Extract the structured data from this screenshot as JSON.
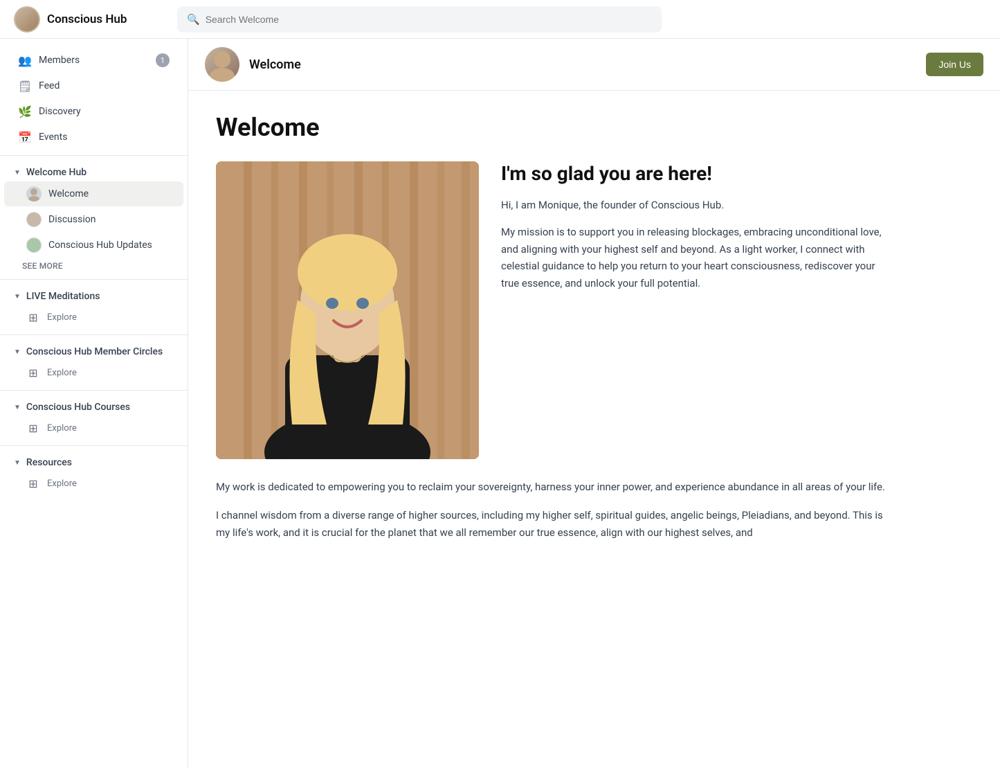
{
  "app": {
    "title": "Conscious Hub",
    "search_placeholder": "Search Welcome"
  },
  "topnav": {
    "join_button": "Join Us"
  },
  "sidebar": {
    "top_items": [
      {
        "id": "members",
        "label": "Members",
        "icon": "👥"
      },
      {
        "id": "feed",
        "label": "Feed",
        "icon": "🗒"
      },
      {
        "id": "discovery",
        "label": "Discovery",
        "icon": "🌿"
      },
      {
        "id": "events",
        "label": "Events",
        "icon": "📅"
      }
    ],
    "groups": [
      {
        "id": "welcome-hub",
        "label": "Welcome Hub",
        "expanded": true,
        "items": [
          {
            "id": "welcome",
            "label": "Welcome",
            "active": true,
            "has_avatar": true
          },
          {
            "id": "discussion",
            "label": "Discussion",
            "has_avatar": true
          },
          {
            "id": "conscious-hub-updates",
            "label": "Conscious Hub Updates",
            "has_avatar": true
          }
        ],
        "see_more": "SEE MORE"
      },
      {
        "id": "live-meditations",
        "label": "LIVE Meditations",
        "expanded": true,
        "items": [
          {
            "id": "explore-1",
            "label": "Explore",
            "is_explore": true
          }
        ]
      },
      {
        "id": "member-circles",
        "label": "Conscious Hub Member Circles",
        "expanded": true,
        "items": [
          {
            "id": "explore-2",
            "label": "Explore",
            "is_explore": true
          }
        ]
      },
      {
        "id": "courses",
        "label": "Conscious Hub Courses",
        "expanded": true,
        "items": [
          {
            "id": "explore-3",
            "label": "Explore",
            "is_explore": true
          }
        ]
      },
      {
        "id": "resources",
        "label": "Resources",
        "expanded": true,
        "items": [
          {
            "id": "explore-4",
            "label": "Explore",
            "is_explore": true
          }
        ]
      }
    ]
  },
  "content_header": {
    "title": "Welcome"
  },
  "page": {
    "title": "Welcome",
    "headline": "I'm so glad you are here!",
    "intro_text": "Hi, I am Monique, the founder of Conscious Hub.",
    "body_text": "My mission is to support you in releasing blockages, embracing unconditional love, and aligning with your highest self and beyond. As a light worker, I connect with celestial guidance to help you return to your heart consciousness, rediscover your true essence, and unlock your full potential.",
    "full_text": "My work is dedicated to empowering you to reclaim your sovereignty, harness your inner power, and experience abundance in all areas of your life.",
    "paragraph2": "I channel wisdom from a diverse range of higher sources, including my higher self, spiritual guides, angelic beings, Pleiadians, and beyond. This is my life's work, and it is crucial for the planet that we all remember our true essence, align with our highest selves, and"
  }
}
